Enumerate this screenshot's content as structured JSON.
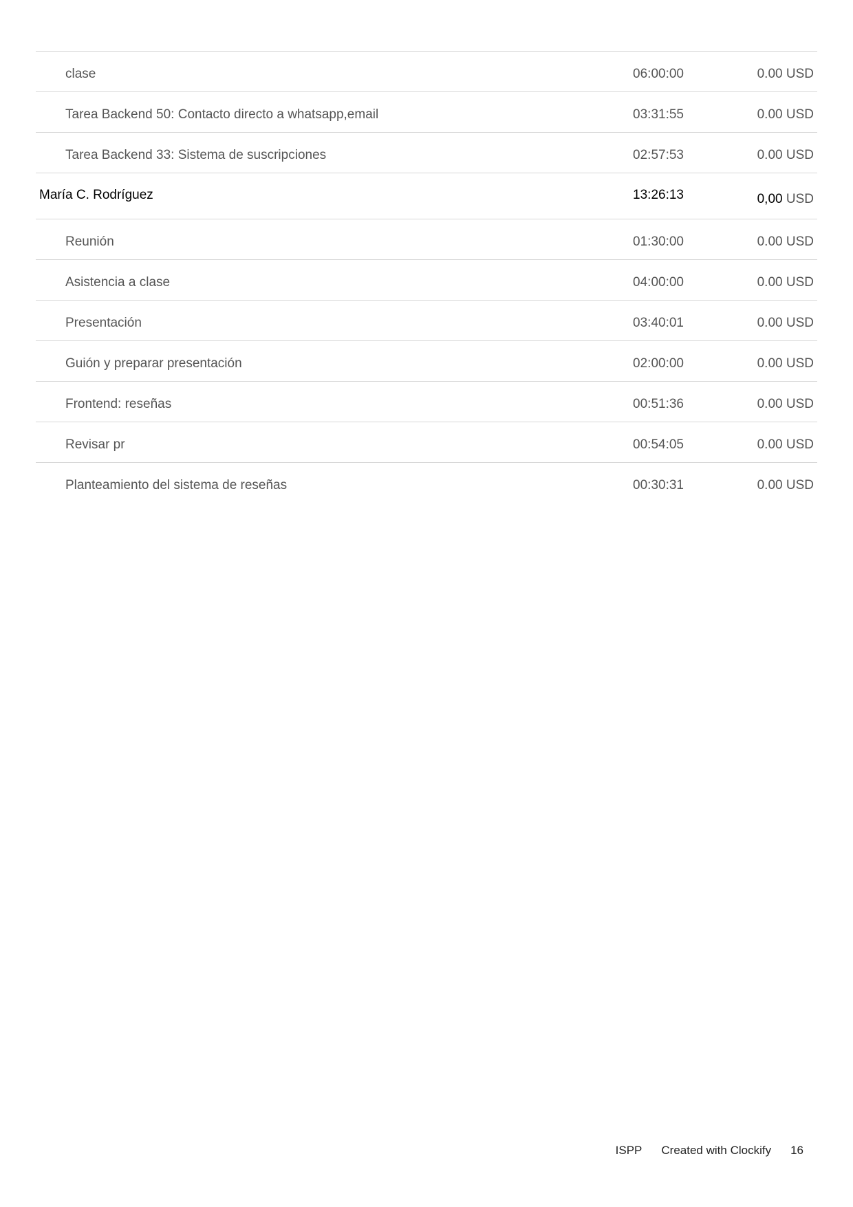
{
  "rows": [
    {
      "type": "entry",
      "description": "clase",
      "time": "06:00:00",
      "amount": "0.00",
      "currency": "USD"
    },
    {
      "type": "entry",
      "description": "Tarea Backend 50: Contacto directo a whatsapp,email",
      "time": "03:31:55",
      "amount": "0.00",
      "currency": "USD"
    },
    {
      "type": "entry",
      "description": "Tarea Backend 33: Sistema de suscripciones",
      "time": "02:57:53",
      "amount": "0.00",
      "currency": "USD"
    },
    {
      "type": "group",
      "description": "María C. Rodríguez",
      "time": "13:26:13",
      "amount": "0,00",
      "currency": "USD"
    },
    {
      "type": "entry",
      "description": "Reunión",
      "time": "01:30:00",
      "amount": "0.00",
      "currency": "USD"
    },
    {
      "type": "entry",
      "description": "Asistencia a clase",
      "time": "04:00:00",
      "amount": "0.00",
      "currency": "USD"
    },
    {
      "type": "entry",
      "description": "Presentación",
      "time": "03:40:01",
      "amount": "0.00",
      "currency": "USD"
    },
    {
      "type": "entry",
      "description": "Guión y preparar presentación",
      "time": "02:00:00",
      "amount": "0.00",
      "currency": "USD"
    },
    {
      "type": "entry",
      "description": "Frontend: reseñas",
      "time": "00:51:36",
      "amount": "0.00",
      "currency": "USD"
    },
    {
      "type": "entry",
      "description": "Revisar pr",
      "time": "00:54:05",
      "amount": "0.00",
      "currency": "USD"
    },
    {
      "type": "entry",
      "description": "Planteamiento del sistema de reseñas",
      "time": "00:30:31",
      "amount": "0.00",
      "currency": "USD"
    }
  ],
  "footer": {
    "project": "ISPP",
    "credit": "Created with Clockify",
    "page_number": "16"
  }
}
